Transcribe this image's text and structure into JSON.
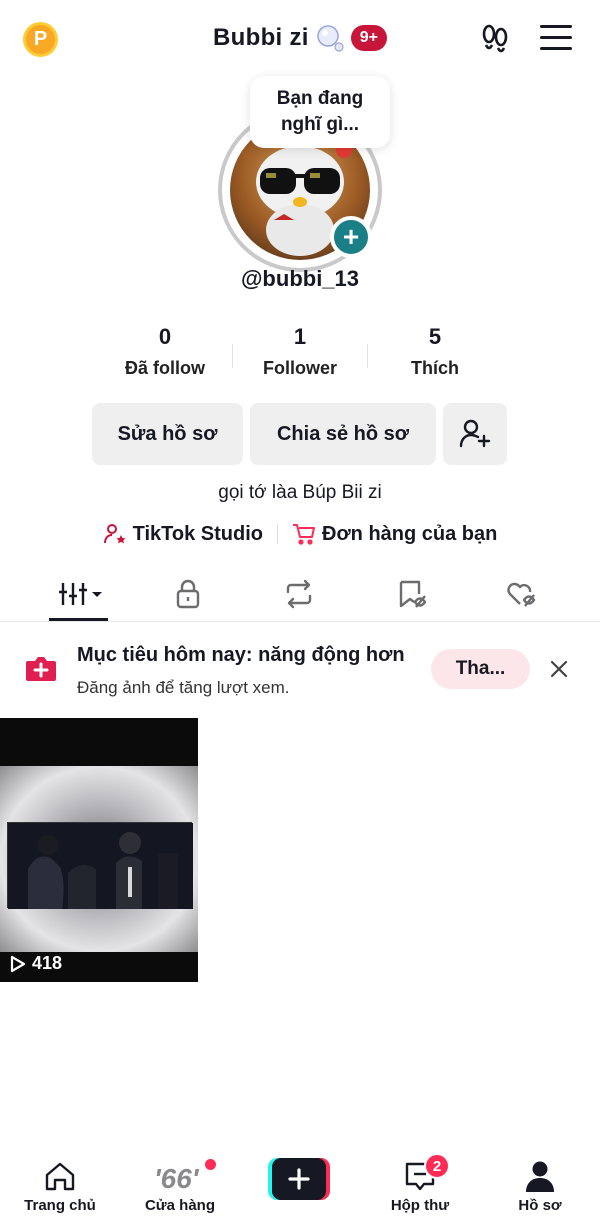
{
  "header": {
    "coin_label": "P",
    "title": "Bubbi zi",
    "notification_badge": "9+"
  },
  "profile": {
    "thought_bubble": "Bạn đang nghĩ gì...",
    "username": "@bubbi_13",
    "bio": "gọi tớ làa Búp Bii zi"
  },
  "stats": [
    {
      "value": "0",
      "label": "Đã follow"
    },
    {
      "value": "1",
      "label": "Follower"
    },
    {
      "value": "5",
      "label": "Thích"
    }
  ],
  "actions": {
    "edit_profile": "Sửa hồ sơ",
    "share_profile": "Chia sẻ hồ sơ"
  },
  "links": {
    "studio": "TikTok Studio",
    "orders": "Đơn hàng của bạn"
  },
  "tabs": [
    {
      "icon": "videos-grid-icon",
      "active": true
    },
    {
      "icon": "lock-icon"
    },
    {
      "icon": "repost-icon"
    },
    {
      "icon": "bookmark-icon"
    },
    {
      "icon": "liked-icon"
    }
  ],
  "goal": {
    "title": "Mục tiêu hôm nay: năng động hơn",
    "subtitle": "Đăng ảnh để tăng lượt xem.",
    "button": "Tha..."
  },
  "videos": [
    {
      "plays": "418"
    }
  ],
  "bottom_nav": {
    "home": "Trang chủ",
    "shop": "Cửa hàng",
    "inbox": "Hộp thư",
    "inbox_badge": "2",
    "profile": "Hồ sơ"
  },
  "colors": {
    "accent_red": "#fe2c55",
    "teal": "#1a7f86",
    "badge_red": "#c8153a"
  }
}
